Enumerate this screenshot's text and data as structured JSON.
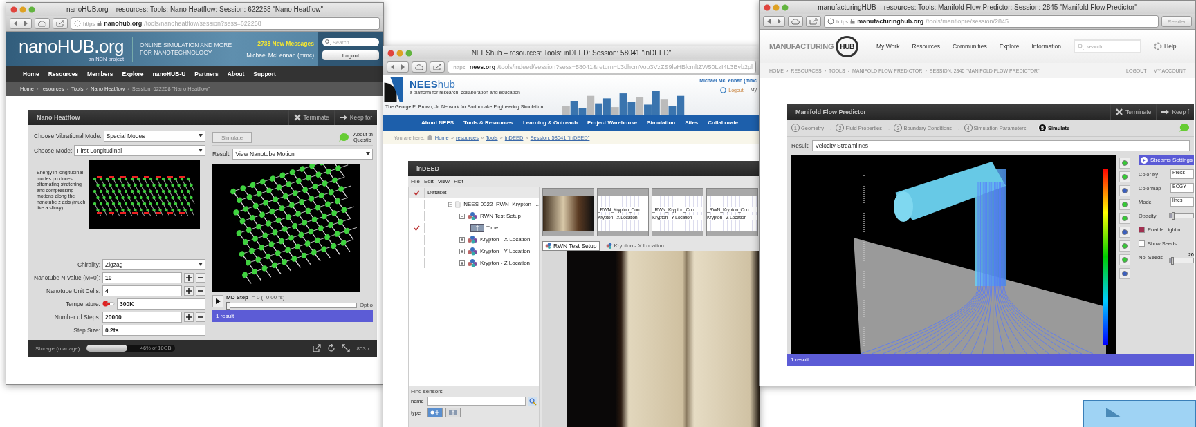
{
  "nanohub": {
    "title": "nanoHUB.org – resources: Tools: Nano Heatflow: Session: 622258 \"Nano Heatflow\"",
    "url": {
      "scheme": "https",
      "host": "nanohub.org",
      "path": "/tools/nanoheatflow/session?sess=622258"
    },
    "logo": "nanoHUB.org",
    "logo_sub": "an NCN project",
    "tagline": "ONLINE SIMULATION AND MORE FOR NANOTECHNOLOGY",
    "messages": "2738 New Messages",
    "user": "Michael McLennan (mmc)",
    "search_placeholder": "Search",
    "logout": "Logout",
    "nav": [
      "Home",
      "Resources",
      "Members",
      "Explore",
      "nanoHUB-U",
      "Partners",
      "About",
      "Support"
    ],
    "breadcrumb": {
      "separator": "›",
      "items": [
        "Home",
        "resources",
        "Tools",
        "Nano Heatflow"
      ],
      "current": "Session: 622258 \"Nano Heatflow\""
    },
    "tool": {
      "title": "Nano Heatflow",
      "actions": [
        "Terminate",
        "Keep for"
      ],
      "selects": [
        {
          "label": "Choose Vibrational Mode:",
          "value": "Special Modes"
        },
        {
          "label": "Choose Mode:",
          "value": "First Longitudinal"
        }
      ],
      "description": "Energy in longitudinal modes produces alternating stretching and compressing motions along the nanotube z axis (much like a slinky).",
      "fields": [
        {
          "kind": "select",
          "label": "Chirality:",
          "value": "Zigzag"
        },
        {
          "kind": "stepper",
          "label": "Nanotube N Value (M=0):",
          "value": "10"
        },
        {
          "kind": "stepper",
          "label": "Nanotube Unit Cells:",
          "value": "4"
        },
        {
          "kind": "temperature",
          "label": "Temperature:",
          "value": "300K"
        },
        {
          "kind": "stepper",
          "label": "Number of Steps:",
          "value": "20000"
        },
        {
          "kind": "text",
          "label": "Step Size:",
          "value": "0.2fs"
        }
      ],
      "simulate": {
        "label": "Simulate",
        "disabled": true
      },
      "about": [
        "About th",
        "Questio"
      ],
      "result_label": "Result:",
      "result": "View Nanotube Motion",
      "md_step": {
        "label": "MD Step",
        "reading": "= 0 (  0.00 fs)",
        "level": 0
      },
      "options": "Optio",
      "results_bar": "1 result",
      "storage": {
        "label": "Storage (manage)",
        "level": 0.46,
        "reading": "46% of 10GB"
      },
      "size": "803 x"
    }
  },
  "nees": {
    "title": "NEEShub – resources: Tools: inDEED: Session: 58041 \"inDEED\"",
    "url": {
      "scheme": "https",
      "host": "nees.org",
      "path": "/tools/indeed/session?sess=58041&return=L3dhcmVob3VzZS9leHBlcmltZW50LzI4L3Byb2pl"
    },
    "logo": "NEES",
    "logo_suffix": "hub",
    "tagline": "a platform for research, collaboration and education",
    "network": "The George E. Brown, Jr. Network for Earthquake Engineering Simulation",
    "user": "Michael McLennan (mmc",
    "logout": "Logout",
    "my": "My",
    "nav": [
      "About NEES",
      "Tools & Resources",
      "Learning & Outreach",
      "Project Warehouse",
      "Simulation",
      "Sites",
      "Collaborate"
    ],
    "breadcrumb": {
      "prefix": "You are here:",
      "separator": "»",
      "items": [
        "Home",
        "resources",
        "Tools",
        "inDEED",
        "Session: 58041 \"inDEED\""
      ]
    },
    "tool": {
      "title": "inDEED",
      "menu": [
        "File",
        "Edit",
        "View",
        "Plot"
      ],
      "tree_header": {
        "label": "Dataset",
        "checked": true
      },
      "tree": [
        {
          "kind": "dataset",
          "label": "NEES-0022_RWN_Krypton_...",
          "checked": false,
          "expanded": true,
          "children": [
            {
              "kind": "group",
              "label": "RWN Test Setup",
              "checked": false,
              "expanded": true,
              "children": [
                {
                  "kind": "sensor",
                  "label": "Time",
                  "checked": true
                }
              ]
            },
            {
              "kind": "group",
              "label": "Krypton - X Location",
              "checked": false,
              "expanded": false
            },
            {
              "kind": "group",
              "label": "Krypton - Y Location",
              "checked": false,
              "expanded": false
            },
            {
              "kind": "group",
              "label": "Krypton - Z Location",
              "checked": false,
              "expanded": false
            }
          ]
        }
      ],
      "thumbnails": [
        {
          "kind": "photo"
        },
        {
          "kind": "plot",
          "lines": [
            "_RWN_Krypton_Con",
            "Krypton - X Location"
          ]
        },
        {
          "kind": "plot",
          "lines": [
            "_RWN_Krypton_Con",
            "Krypton - Y Location"
          ]
        },
        {
          "kind": "plot",
          "lines": [
            "_RWN_Krypton_Con",
            "Krypton - Z Location"
          ]
        }
      ],
      "tabs": [
        {
          "label": "RWN Test Setup",
          "selected": true
        },
        {
          "label": "Krypton - X Location",
          "selected": false
        }
      ],
      "find": {
        "title": "Find sensors",
        "name_label": "name",
        "type_label": "type"
      }
    }
  },
  "manufacturing": {
    "title": "manufacturingHUB – resources: Tools: Manifold Flow Predictor: Session: 2845 \"Manifold Flow Predictor\"",
    "url": {
      "scheme": "https",
      "host": "manufacturinghub.org",
      "path": "/tools/manflopre/session/2845"
    },
    "reader": "Reader",
    "logo": [
      "MANUFACTURING",
      "HUB"
    ],
    "nav": [
      "My Work",
      "Resources",
      "Communities",
      "Explore",
      "Information"
    ],
    "search_placeholder": "search",
    "help": "Help",
    "breadcrumb": {
      "separator": "›",
      "items": [
        "HOME",
        "RESOURCES",
        "TOOLS",
        "MANIFOLD FLOW PREDICTOR",
        "SESSION: 2845 \"MANIFOLD FLOW PREDICTOR\""
      ]
    },
    "account": [
      "LOGOUT",
      "MY ACCOUNT"
    ],
    "account_separator": "|",
    "tool": {
      "title": "Manifold Flow Predictor",
      "actions": [
        "Terminate",
        "Keep f"
      ],
      "step_separator": "→",
      "steps": [
        {
          "number": "1",
          "label": "Geometry",
          "selected": false
        },
        {
          "number": "2",
          "label": "Fluid Properties",
          "selected": false
        },
        {
          "number": "3",
          "label": "Boundary Conditions",
          "selected": false
        },
        {
          "number": "4",
          "label": "Simulation Parameters",
          "selected": false
        },
        {
          "number": "5",
          "label": "Simulate",
          "selected": true
        }
      ],
      "result_label": "Result:",
      "result": "Velocity Streamlines",
      "settings": {
        "title": "Streams Settings",
        "rows": [
          {
            "kind": "select",
            "label": "Color by",
            "value": "Press"
          },
          {
            "kind": "select",
            "label": "Colormap",
            "value": "BCGY"
          },
          {
            "kind": "select",
            "label": "Mode",
            "value": "lines"
          },
          {
            "kind": "slider",
            "label": "Opacity",
            "level": 0.1
          },
          {
            "kind": "check",
            "label": "Enable Lightin",
            "checked": true
          },
          {
            "kind": "check",
            "label": "Show Seeds",
            "checked": false
          },
          {
            "kind": "slider",
            "label": "No. Seeds",
            "reading": "20",
            "level": 0.05
          }
        ]
      },
      "results_bar": "1 result"
    }
  }
}
